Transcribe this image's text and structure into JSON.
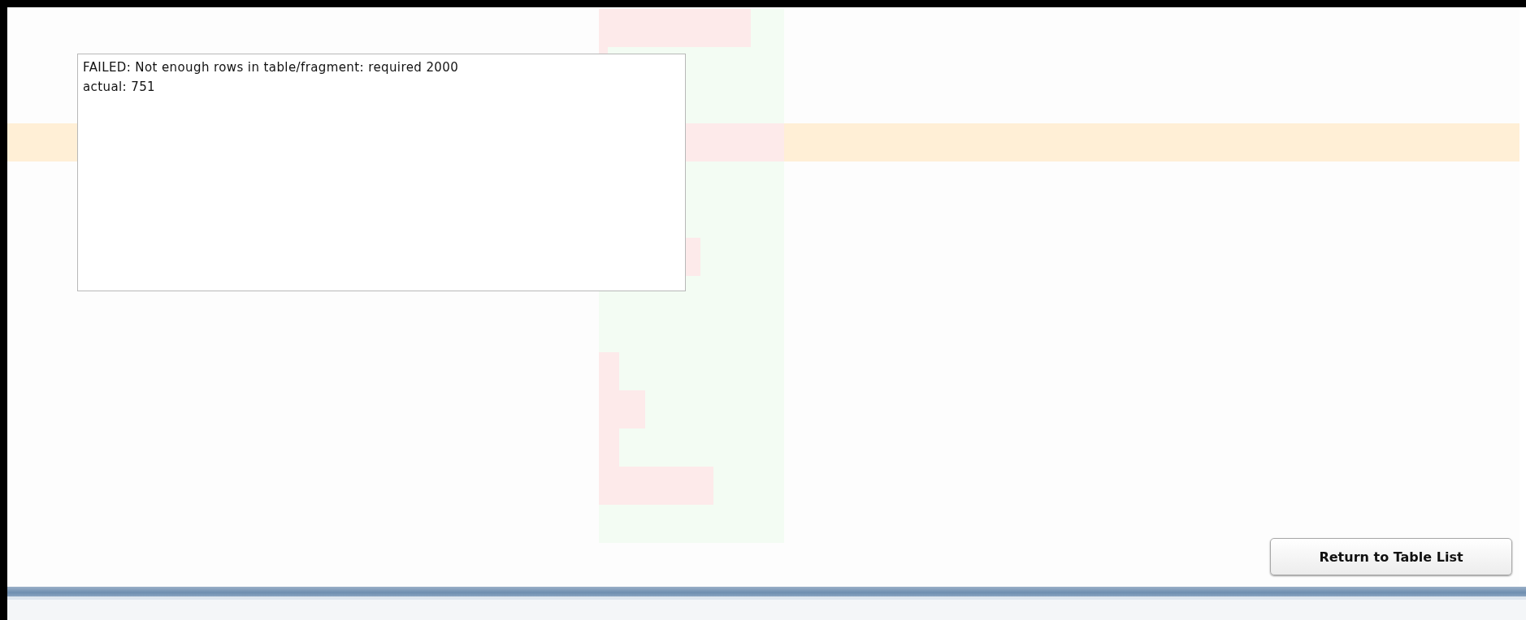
{
  "rows": [
    {
      "level": 0.82,
      "selected": false
    },
    {
      "level": 0.05,
      "selected": false
    },
    {
      "selected": false
    },
    {
      "level": 1.0,
      "selected": true
    },
    {
      "selected": false
    },
    {
      "selected": false
    },
    {
      "level": 0.55,
      "selected": false
    },
    {
      "selected": false
    },
    {
      "selected": false
    },
    {
      "level": 0.11,
      "selected": false
    },
    {
      "level": 0.25,
      "selected": false
    },
    {
      "level": 0.11,
      "selected": false
    },
    {
      "level": 0.62,
      "selected": false
    },
    {
      "selected": false
    }
  ],
  "message": {
    "lines": [
      "FAILED: Not enough rows in table/fragment:  required 2000",
      "actual: 751"
    ]
  },
  "return_button": {
    "label": "Return to Table List"
  }
}
